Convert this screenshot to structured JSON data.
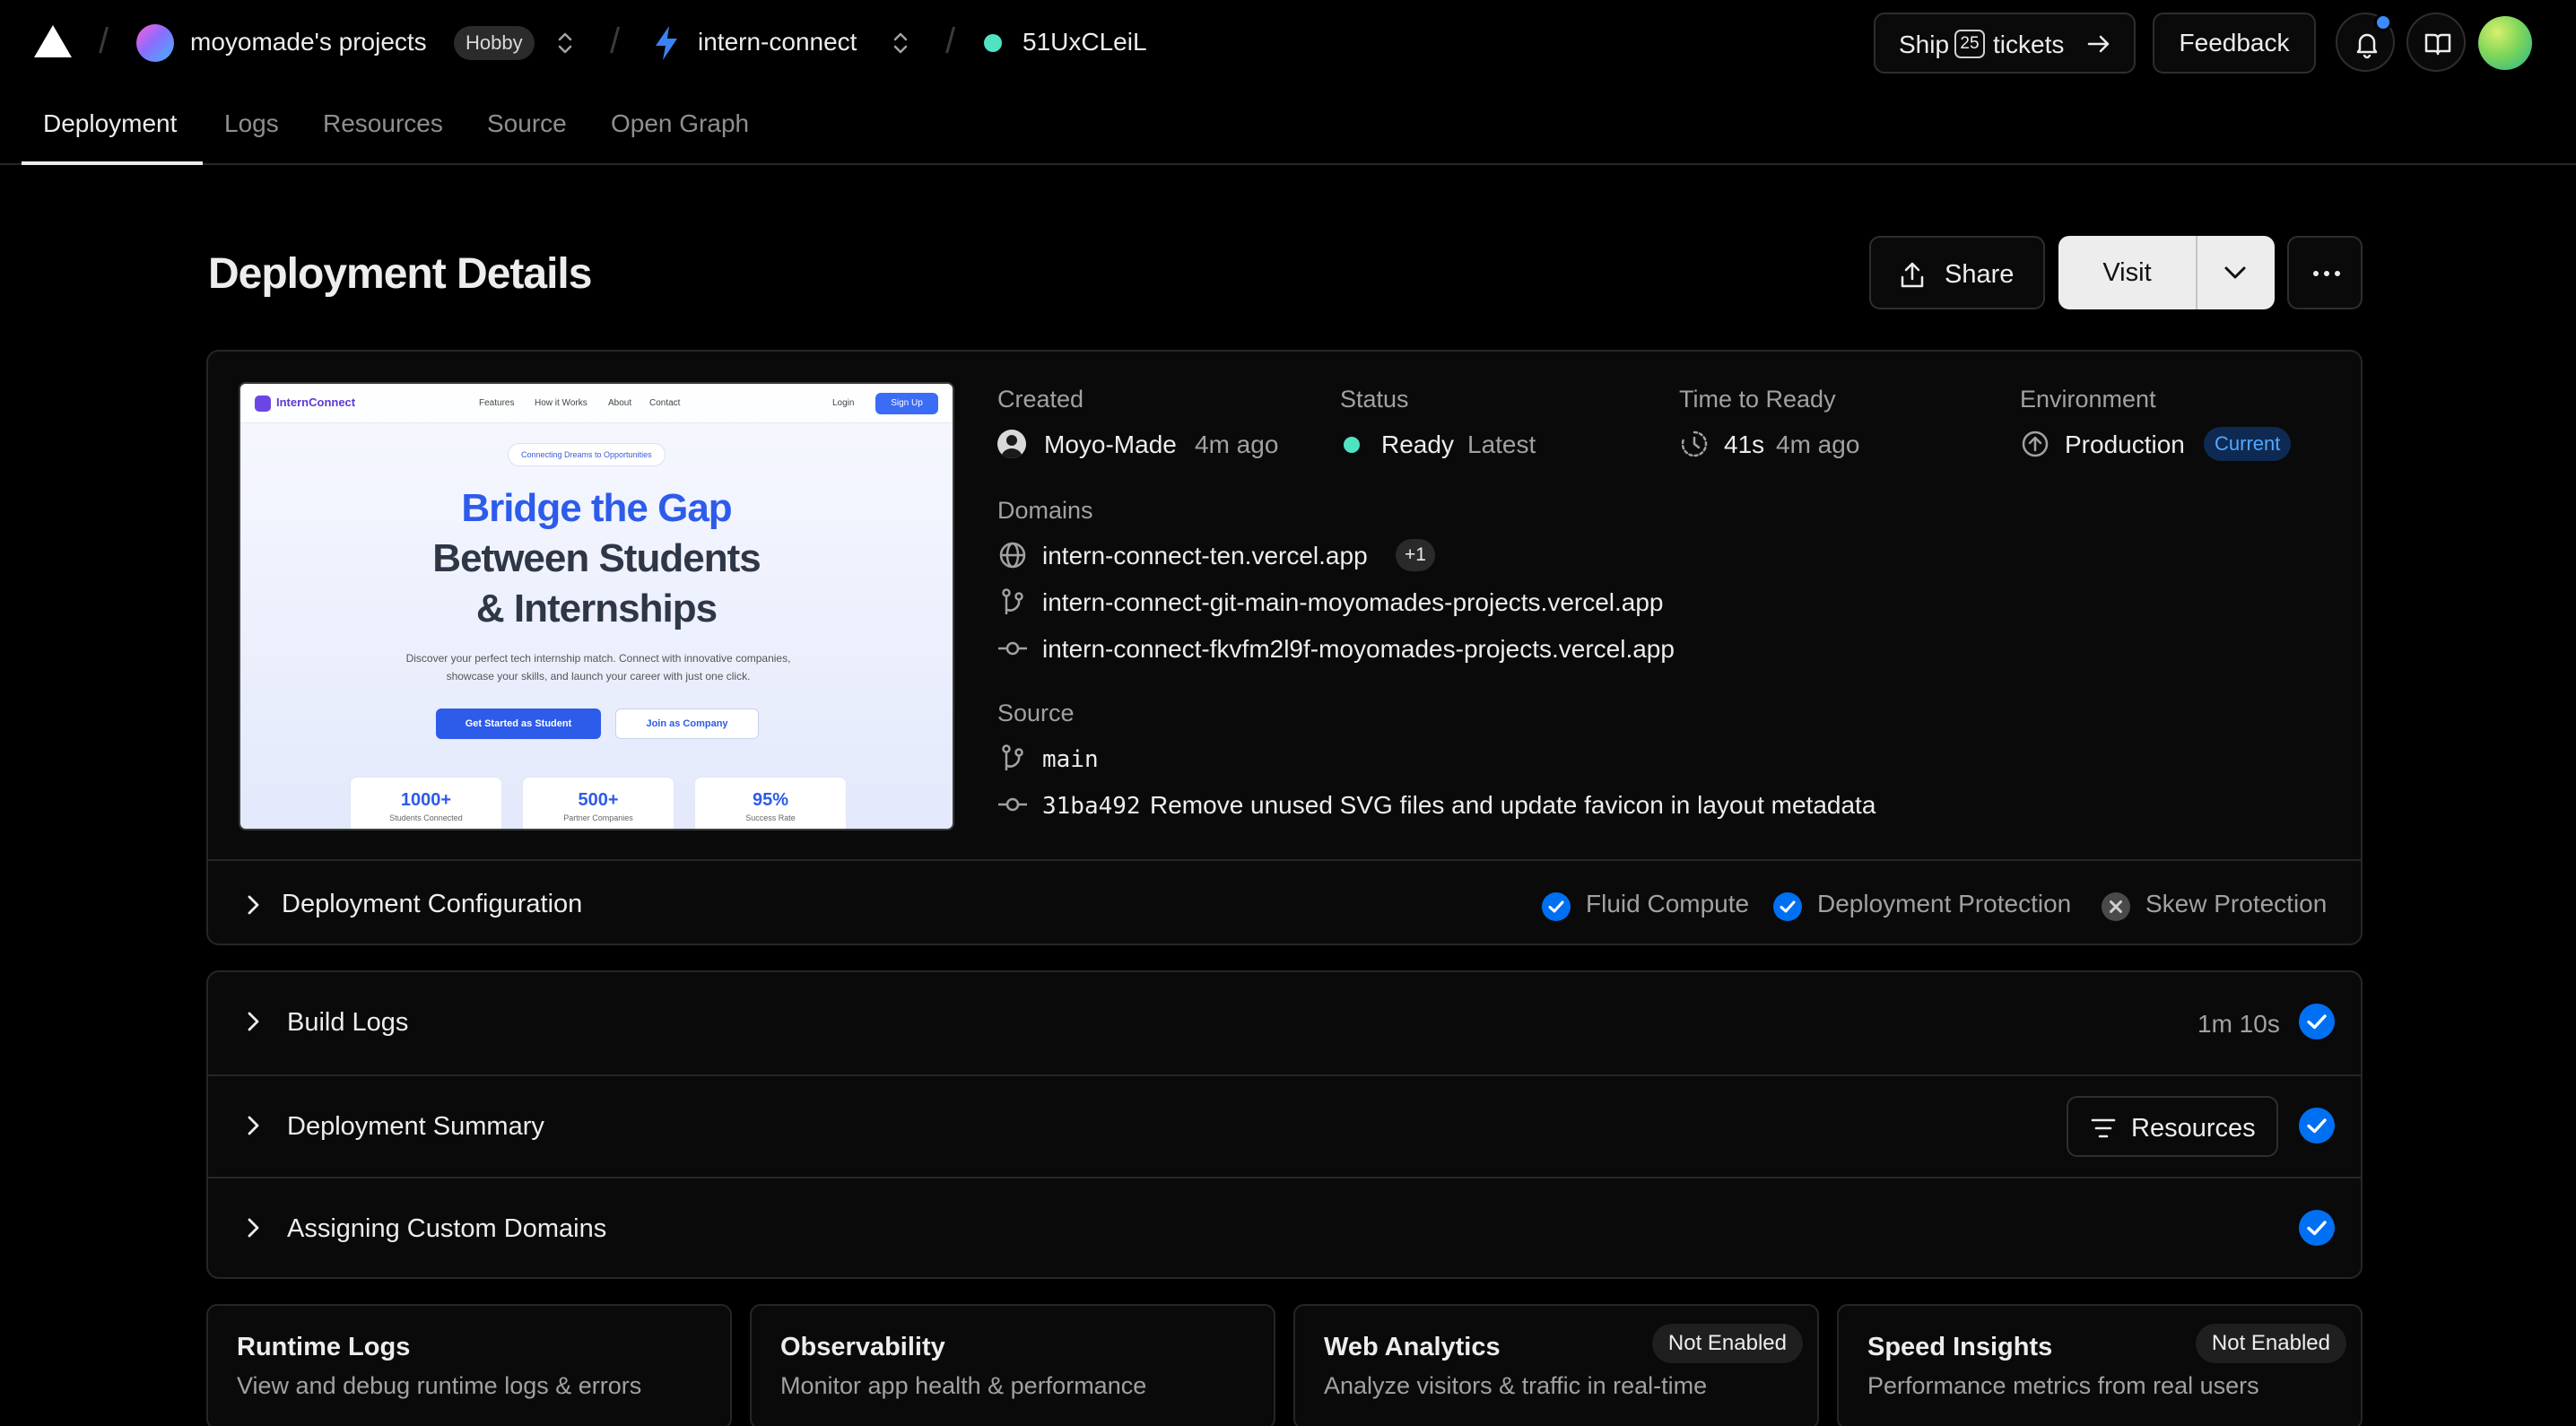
{
  "topbar": {
    "workspace_name": "moyomade's projects",
    "plan_badge": "Hobby",
    "project_name": "intern-connect",
    "deployment_id": "51UxCLeiL",
    "ship_prefix": "Ship",
    "ship_count": "25",
    "ship_suffix": "tickets",
    "feedback_label": "Feedback",
    "icons": [
      "vercel-logo-icon",
      "chevron-up-down-icon",
      "bolt-icon",
      "arrow-right-icon",
      "bell-icon",
      "book-icon"
    ]
  },
  "tabs": [
    "Deployment",
    "Logs",
    "Resources",
    "Source",
    "Open Graph"
  ],
  "active_tab": "Deployment",
  "page": {
    "title": "Deployment Details",
    "share_label": "Share",
    "visit_label": "Visit"
  },
  "preview": {
    "brand": "InternConnect",
    "nav_links": [
      "Features",
      "How it Works",
      "About",
      "Contact"
    ],
    "login": "Login",
    "signup": "Sign Up",
    "pill": "Connecting Dreams to Opportunities",
    "headline_1": "Bridge the Gap",
    "headline_2": "Between Students",
    "headline_3": "& Internships",
    "subtext_1": "Discover your perfect tech internship match. Connect with innovative companies,",
    "subtext_2": "showcase your skills, and launch your career with just one click.",
    "cta_student": "Get Started as Student",
    "cta_company": "Join as Company",
    "stats": [
      {
        "num": "1000+",
        "label": "Students Connected"
      },
      {
        "num": "500+",
        "label": "Partner Companies"
      },
      {
        "num": "95%",
        "label": "Success Rate"
      }
    ]
  },
  "details": {
    "created_label": "Created",
    "creator": "Moyo-Made",
    "created_ago": "4m ago",
    "status_label": "Status",
    "status": "Ready",
    "status_tag": "Latest",
    "ttr_label": "Time to Ready",
    "ttr": "41s",
    "ttr_ago": "4m ago",
    "env_label": "Environment",
    "env": "Production",
    "env_badge": "Current",
    "domains_label": "Domains",
    "domain_1": "intern-connect-ten.vercel.app",
    "domain_1_extra": "+1",
    "domain_2": "intern-connect-git-main-moyomades-projects.vercel.app",
    "domain_3": "intern-connect-fkvfm2l9f-moyomades-projects.vercel.app",
    "source_label": "Source",
    "branch": "main",
    "commit_hash": "31ba492",
    "commit_msg": "Remove unused SVG files and update favicon in layout metadata"
  },
  "config": {
    "title": "Deployment Configuration",
    "features": [
      {
        "label": "Fluid Compute",
        "enabled": true
      },
      {
        "label": "Deployment Protection",
        "enabled": true
      },
      {
        "label": "Skew Protection",
        "enabled": false
      }
    ]
  },
  "accordion": {
    "build_logs": "Build Logs",
    "build_duration": "1m 10s",
    "summary": "Deployment Summary",
    "resources_label": "Resources",
    "domains": "Assigning Custom Domains"
  },
  "cards": [
    {
      "title": "Runtime Logs",
      "desc": "View and debug runtime logs & errors",
      "badge": ""
    },
    {
      "title": "Observability",
      "desc": "Monitor app health & performance",
      "badge": ""
    },
    {
      "title": "Web Analytics",
      "desc": "Analyze visitors & traffic in real-time",
      "badge": "Not Enabled"
    },
    {
      "title": "Speed Insights",
      "desc": "Performance metrics from real users",
      "badge": "Not Enabled"
    }
  ],
  "colors": {
    "background": "#000000",
    "accent_blue": "#0070f3",
    "ready_green": "#50e3c2",
    "current_badge": "#52a8ff"
  }
}
